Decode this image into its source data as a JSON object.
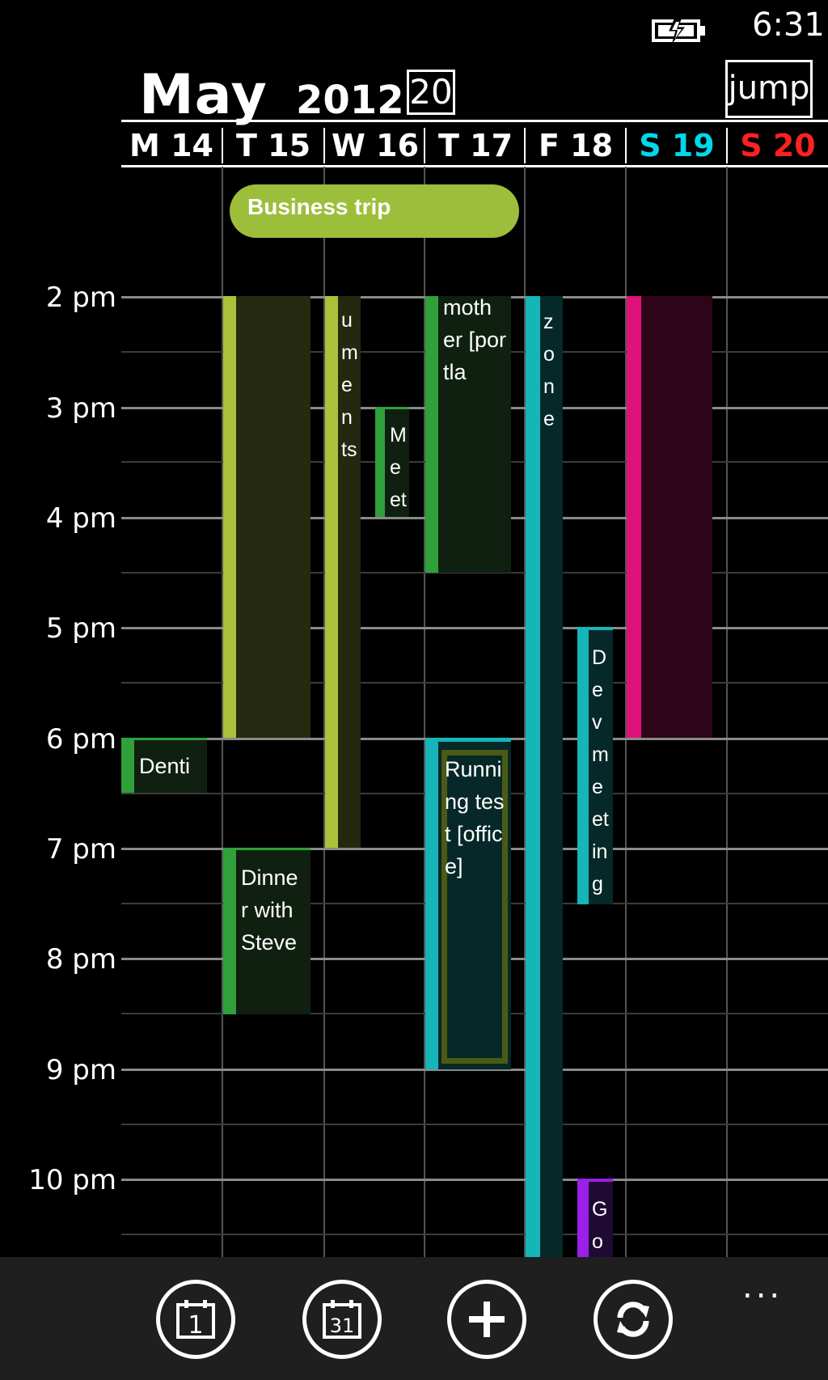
{
  "status_bar": {
    "time": "6:31",
    "battery_icon": "battery-charging-icon"
  },
  "header": {
    "month": "May",
    "year": "2012",
    "today": "20",
    "jump_label": "jump"
  },
  "days": [
    {
      "label": "M 14",
      "color": "#ffffff"
    },
    {
      "label": "T 15",
      "color": "#ffffff"
    },
    {
      "label": "W 16",
      "color": "#ffffff"
    },
    {
      "label": "T 17",
      "color": "#ffffff"
    },
    {
      "label": "F 18",
      "color": "#ffffff"
    },
    {
      "label": "S 19",
      "color": "#00d8e8"
    },
    {
      "label": "S 20",
      "color": "#ff2020"
    }
  ],
  "all_day_events": [
    {
      "title": "Business trip",
      "color": "#9dbe3b"
    }
  ],
  "hour_labels": [
    "2 pm",
    "3 pm",
    "4 pm",
    "5 pm",
    "6 pm",
    "7 pm",
    "8 pm",
    "9 pm",
    "10 pm"
  ],
  "events": [
    {
      "id": "dentist",
      "title": "Denti",
      "color": "#2fa03a"
    },
    {
      "id": "t15-block",
      "title": "",
      "color": "#a9c23a"
    },
    {
      "id": "dinner",
      "title": "Dinne r with Steve",
      "color": "#2fa03a"
    },
    {
      "id": "w16-block",
      "title": "u m e n ts",
      "color": "#a9c23a"
    },
    {
      "id": "meet",
      "title": "M e et",
      "color": "#2fa03a"
    },
    {
      "id": "mother",
      "title": "moth er [portla",
      "color": "#2fa03a"
    },
    {
      "id": "running",
      "title": "Runni ng test [office]",
      "color": "#16b5b8"
    },
    {
      "id": "zone",
      "title": "z o n e",
      "color": "#16b5b8"
    },
    {
      "id": "devmeeting",
      "title": "D e v m e et in g",
      "color": "#16b5b8"
    },
    {
      "id": "go",
      "title": "G o",
      "color": "#9b1fe8"
    },
    {
      "id": "s19-block",
      "title": "",
      "color": "#e0127a"
    }
  ],
  "app_bar": {
    "buttons": [
      {
        "name": "day-view",
        "icon": "calendar-1-icon",
        "glyph": "1"
      },
      {
        "name": "month-view",
        "icon": "calendar-31-icon",
        "glyph": "31"
      },
      {
        "name": "add",
        "icon": "plus-icon",
        "glyph": "+"
      },
      {
        "name": "sync",
        "icon": "sync-icon",
        "glyph": "⟳"
      }
    ],
    "more": "..."
  }
}
